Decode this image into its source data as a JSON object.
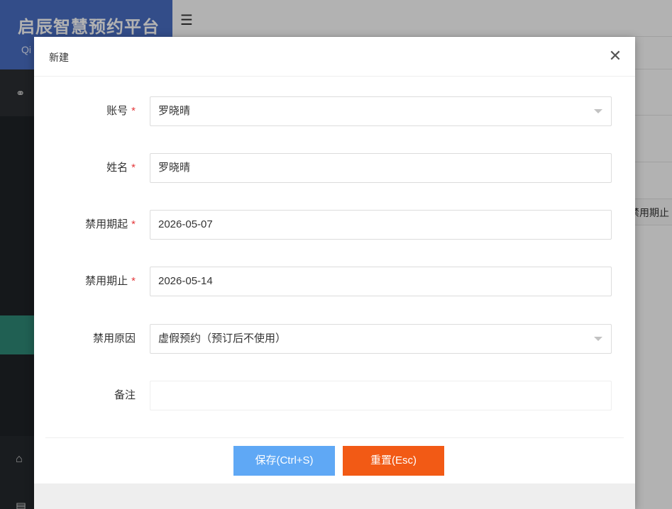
{
  "brand": {
    "title": "启辰智慧预约平台",
    "subtitle": "Qi"
  },
  "background_table": {
    "visible_header": "禁用期止"
  },
  "modal": {
    "title": "新建",
    "fields": [
      {
        "label": "账号",
        "required": true,
        "value": "罗晓晴",
        "type": "select"
      },
      {
        "label": "姓名",
        "required": true,
        "value": "罗晓晴",
        "type": "text"
      },
      {
        "label": "禁用期起",
        "required": true,
        "value": "2026-05-07",
        "type": "date"
      },
      {
        "label": "禁用期止",
        "required": true,
        "value": "2026-05-14",
        "type": "date"
      },
      {
        "label": "禁用原因",
        "required": false,
        "value": "虚假预约（预订后不使用）",
        "type": "select"
      },
      {
        "label": "备注",
        "required": false,
        "value": "",
        "type": "text"
      }
    ],
    "required_mark": "*",
    "save_label": "保存(Ctrl+S)",
    "reset_label": "重置(Esc)"
  },
  "colors": {
    "save": "#5fa8f5",
    "reset": "#f25a15",
    "brand": "#4a6fc4",
    "sidebar_active": "#2e8a78"
  },
  "icons": {
    "close": "close-icon",
    "menu": "menu-toggle-icon",
    "caret": "caret-down-icon"
  }
}
